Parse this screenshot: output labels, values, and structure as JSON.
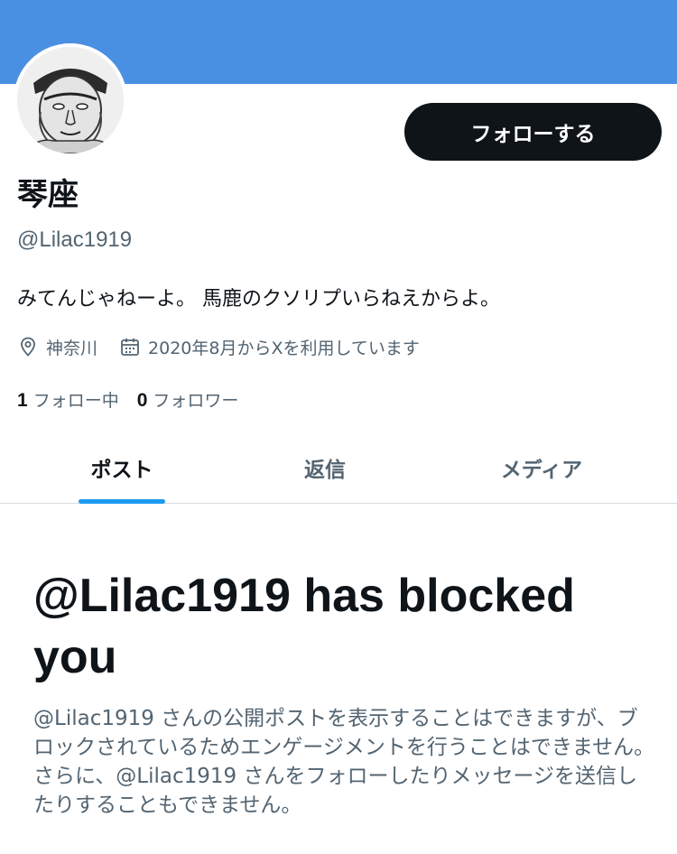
{
  "colors": {
    "banner": "#4a90e2",
    "follow_button_bg": "#0f1419",
    "tab_indicator": "#1d9bf0",
    "secondary_text": "#536471"
  },
  "profile": {
    "display_name": "琴座",
    "handle": "@Lilac1919",
    "bio": "みてんじゃねーよ。 馬鹿のクソリプいらねえからよ。",
    "location": "神奈川",
    "joined": "2020年8月からXを利用しています",
    "follow_button": "フォローする",
    "following_count": "1",
    "following_label": "フォロー中",
    "followers_count": "0",
    "followers_label": "フォロワー"
  },
  "tabs": [
    {
      "label": "ポスト",
      "active": true
    },
    {
      "label": "返信",
      "active": false
    },
    {
      "label": "メディア",
      "active": false
    }
  ],
  "blocked": {
    "title": "@Lilac1919 has blocked you",
    "description": "@Lilac1919 さんの公開ポストを表示することはできますが、ブロックされているためエンゲージメントを行うことはできません。さらに、@Lilac1919 さんをフォローしたりメッセージを送信したりすることもできません。"
  }
}
